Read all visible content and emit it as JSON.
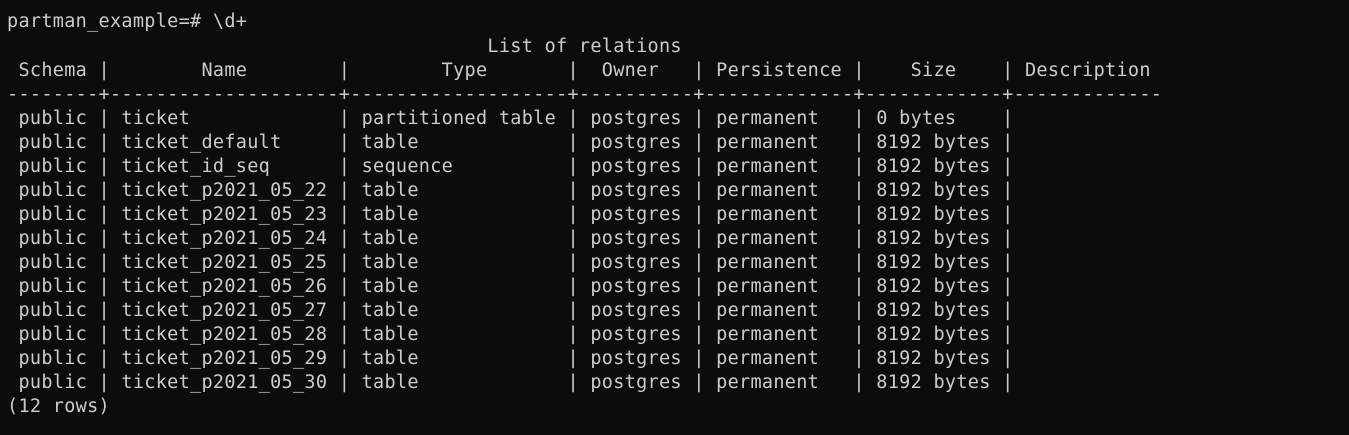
{
  "prompt": "partman_example=# \\d+",
  "table_title": "                                          List of relations",
  "header": " Schema |        Name        |        Type       |  Owner   | Persistence |    Size    | Description ",
  "separator": "--------+--------------------+-------------------+----------+-------------+------------+-------------",
  "rows": [
    " public | ticket             | partitioned table | postgres | permanent   | 0 bytes    |",
    " public | ticket_default     | table             | postgres | permanent   | 8192 bytes |",
    " public | ticket_id_seq      | sequence          | postgres | permanent   | 8192 bytes |",
    " public | ticket_p2021_05_22 | table             | postgres | permanent   | 8192 bytes |",
    " public | ticket_p2021_05_23 | table             | postgres | permanent   | 8192 bytes |",
    " public | ticket_p2021_05_24 | table             | postgres | permanent   | 8192 bytes |",
    " public | ticket_p2021_05_25 | table             | postgres | permanent   | 8192 bytes |",
    " public | ticket_p2021_05_26 | table             | postgres | permanent   | 8192 bytes |",
    " public | ticket_p2021_05_27 | table             | postgres | permanent   | 8192 bytes |",
    " public | ticket_p2021_05_28 | table             | postgres | permanent   | 8192 bytes |",
    " public | ticket_p2021_05_29 | table             | postgres | permanent   | 8192 bytes |",
    " public | ticket_p2021_05_30 | table             | postgres | permanent   | 8192 bytes |"
  ],
  "footer": "(12 rows)"
}
